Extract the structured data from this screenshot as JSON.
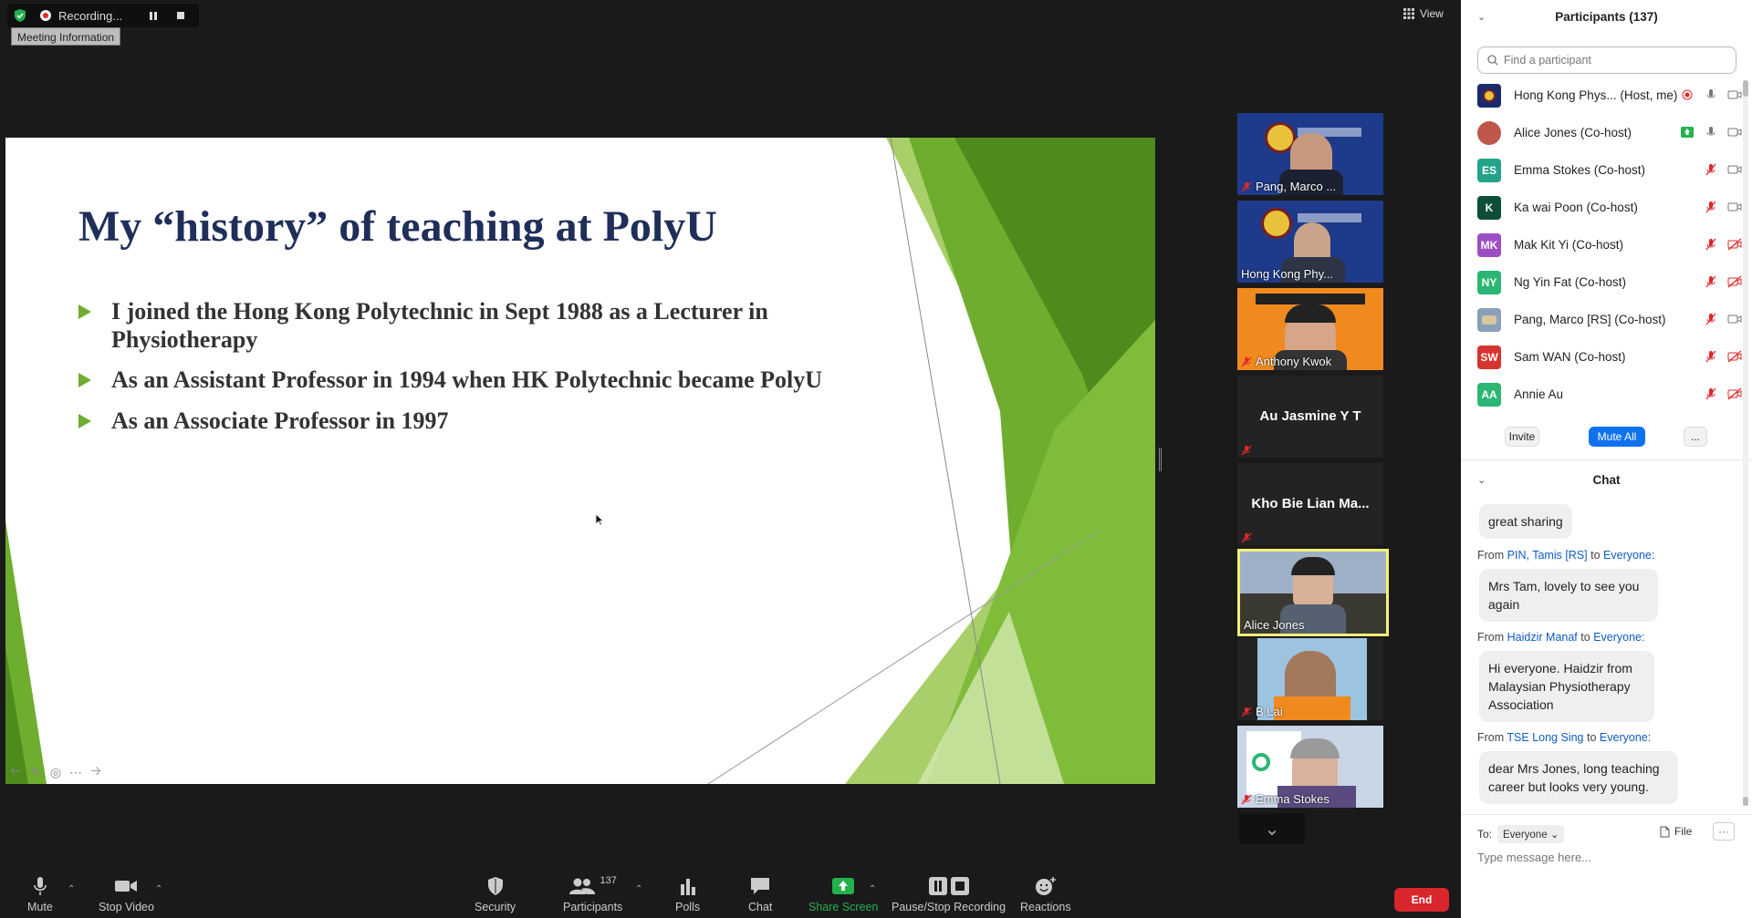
{
  "recording": {
    "label": "Recording...",
    "meeting_info": "Meeting Information"
  },
  "view_label": "View",
  "slide": {
    "title": "My “history” of teaching at PolyU",
    "bullets": [
      "I joined the Hong Kong Polytechnic in Sept 1988 as a Lecturer in Physiotherapy",
      "As an Assistant Professor in 1994 when HK Polytechnic became PolyU",
      "As an Associate Professor in 1997"
    ]
  },
  "thumbnails": [
    {
      "name": "Pang, Marco ...",
      "muted": true
    },
    {
      "name": "Hong Kong Phy...",
      "muted": false
    },
    {
      "name": "Anthony Kwok",
      "muted": true
    },
    {
      "name": "Au Jasmine Y T",
      "muted": true
    },
    {
      "name": "Kho Bie Lian Ma...",
      "muted": true
    },
    {
      "name": "Alice Jones",
      "muted": false
    },
    {
      "name": "B Lai",
      "muted": true
    },
    {
      "name": "Emma Stokes",
      "muted": true
    }
  ],
  "toolbar": {
    "mute": "Mute",
    "stop_video": "Stop Video",
    "security": "Security",
    "participants": "Participants",
    "participants_count": "137",
    "polls": "Polls",
    "chat": "Chat",
    "share_screen": "Share Screen",
    "pause_stop_recording": "Pause/Stop Recording",
    "reactions": "Reactions",
    "end": "End"
  },
  "participants_panel": {
    "title": "Participants (137)",
    "search_placeholder": "Find a participant",
    "participants": [
      {
        "name": "Hong Kong Phys... (Host, me)",
        "initials": "",
        "color": "#1a2a6c"
      },
      {
        "name": "Alice Jones (Co-host)",
        "initials": "",
        "color": "#c0574a"
      },
      {
        "name": "Emma Stokes (Co-host)",
        "initials": "ES",
        "color": "#23a38a"
      },
      {
        "name": "Ka wai Poon (Co-host)",
        "initials": "K",
        "color": "#0e4d3a"
      },
      {
        "name": "Mak Kit Yi (Co-host)",
        "initials": "MK",
        "color": "#9b4fc2"
      },
      {
        "name": "Ng Yin Fat (Co-host)",
        "initials": "NY",
        "color": "#2bb673"
      },
      {
        "name": "Pang, Marco [RS] (Co-host)",
        "initials": "",
        "color": "#8aa0b8"
      },
      {
        "name": "Sam WAN (Co-host)",
        "initials": "SW",
        "color": "#d6352f"
      },
      {
        "name": "Annie Au",
        "initials": "AA",
        "color": "#2bb673"
      }
    ],
    "invite": "Invite",
    "mute_all": "Mute All",
    "more": "..."
  },
  "chat": {
    "title": "Chat",
    "messages": [
      {
        "from": "",
        "to": "",
        "text": "great sharing"
      },
      {
        "from": "PIN, Tamis [RS]",
        "to": "Everyone:",
        "text": "Mrs Tam, lovely to see you again"
      },
      {
        "from": "Haidzir Manaf",
        "to": "Everyone:",
        "text": "Hi everyone. Haidzir from Malaysian Physiotherapy Association"
      },
      {
        "from": "TSE Long Sing",
        "to": "Everyone:",
        "text": "dear Mrs Jones, long teaching career but looks very young."
      }
    ],
    "from_word": "From",
    "to_word": "to",
    "to_label": "To:",
    "to_value": "Everyone",
    "file_label": "File",
    "more": "···",
    "input_placeholder": "Type message here..."
  }
}
